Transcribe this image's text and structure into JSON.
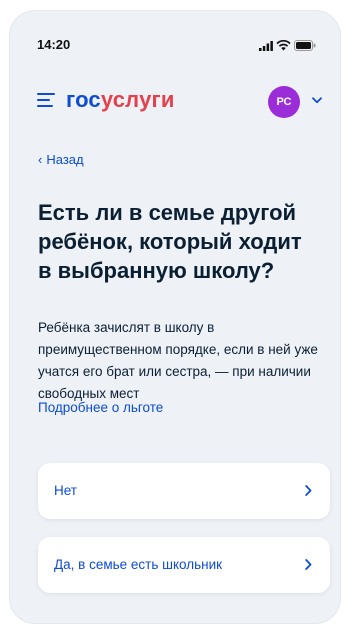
{
  "status_bar": {
    "time": "14:20",
    "signal_icon": "signal-icon",
    "wifi_icon": "wifi-icon",
    "battery_icon": "battery-icon"
  },
  "header": {
    "logo_part1": "гос",
    "logo_part2": "услуги",
    "avatar_initials": "РС",
    "menu_icon": "menu-icon",
    "dropdown_icon": "chevron-down-icon"
  },
  "nav": {
    "back_label": "Назад"
  },
  "main": {
    "title": "Есть ли в семье другой ребёнок, который ходит в выбранную школу?",
    "description": "Ребёнка зачислят в школу в преимущественном порядке, если в ней уже учатся его брат или сестра, — при наличии свободных мест",
    "more_link": "Подробнее о льготе",
    "options": [
      {
        "label": "Нет"
      },
      {
        "label": "Да, в семье есть школьник"
      }
    ]
  },
  "colors": {
    "brand_blue": "#0d4cd3",
    "brand_red": "#e4414d",
    "avatar": "#9b2dd8",
    "background": "#eef1f6"
  }
}
